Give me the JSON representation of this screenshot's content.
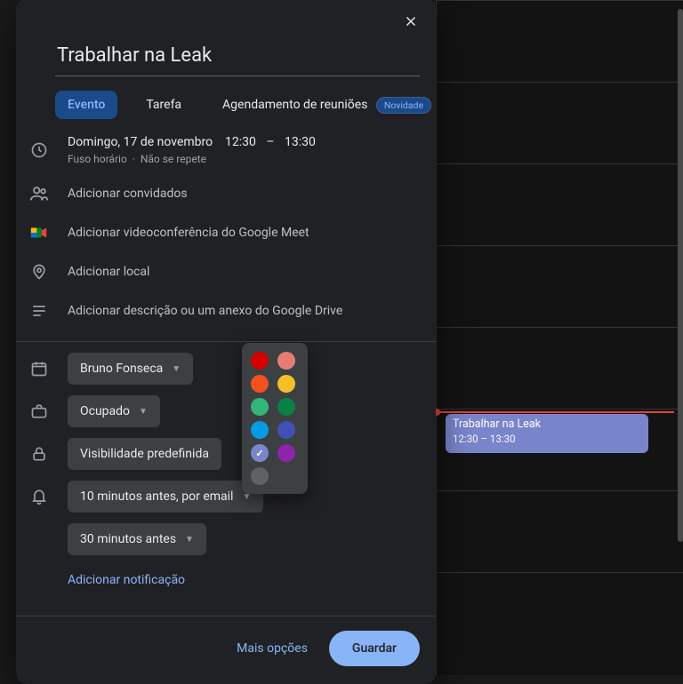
{
  "event": {
    "title": "Trabalhar na Leak",
    "date_label": "Domingo, 17 de novembro",
    "start_time": "12:30",
    "end_time": "13:30",
    "timezone_label": "Fuso horário",
    "repeat_label": "Não se repete"
  },
  "tabs": {
    "event": "Evento",
    "task": "Tarefa",
    "scheduling": "Agendamento de reuniões",
    "badge": "Novidade"
  },
  "rows": {
    "guests": "Adicionar convidados",
    "meet": "Adicionar videoconferência do Google Meet",
    "location": "Adicionar local",
    "description": "Adicionar descrição ou um anexo do Google Drive"
  },
  "options": {
    "calendar_owner": "Bruno Fonseca",
    "busy": "Ocupado",
    "visibility": "Visibilidade predefinida",
    "notif1": "10 minutos antes, por email",
    "notif2": "30 minutos antes",
    "add_notif": "Adicionar notificação"
  },
  "footer": {
    "more": "Mais opções",
    "save": "Guardar"
  },
  "calendar_block": {
    "title": "Trabalhar na Leak",
    "time": "12:30 – 13:30"
  },
  "colors": {
    "list": [
      {
        "name": "tomato",
        "hex": "#d50000",
        "selected": false
      },
      {
        "name": "flamingo",
        "hex": "#e67c73",
        "selected": false
      },
      {
        "name": "tangerine",
        "hex": "#f4511e",
        "selected": false
      },
      {
        "name": "banana",
        "hex": "#f6bf26",
        "selected": false
      },
      {
        "name": "sage",
        "hex": "#33b679",
        "selected": false
      },
      {
        "name": "basil",
        "hex": "#0b8043",
        "selected": false
      },
      {
        "name": "peacock",
        "hex": "#039be5",
        "selected": false
      },
      {
        "name": "blueberry",
        "hex": "#3f51b5",
        "selected": false
      },
      {
        "name": "lavender",
        "hex": "#7986cb",
        "selected": true
      },
      {
        "name": "grape",
        "hex": "#8e24aa",
        "selected": false
      },
      {
        "name": "graphite",
        "hex": "#616161",
        "selected": false
      }
    ]
  }
}
